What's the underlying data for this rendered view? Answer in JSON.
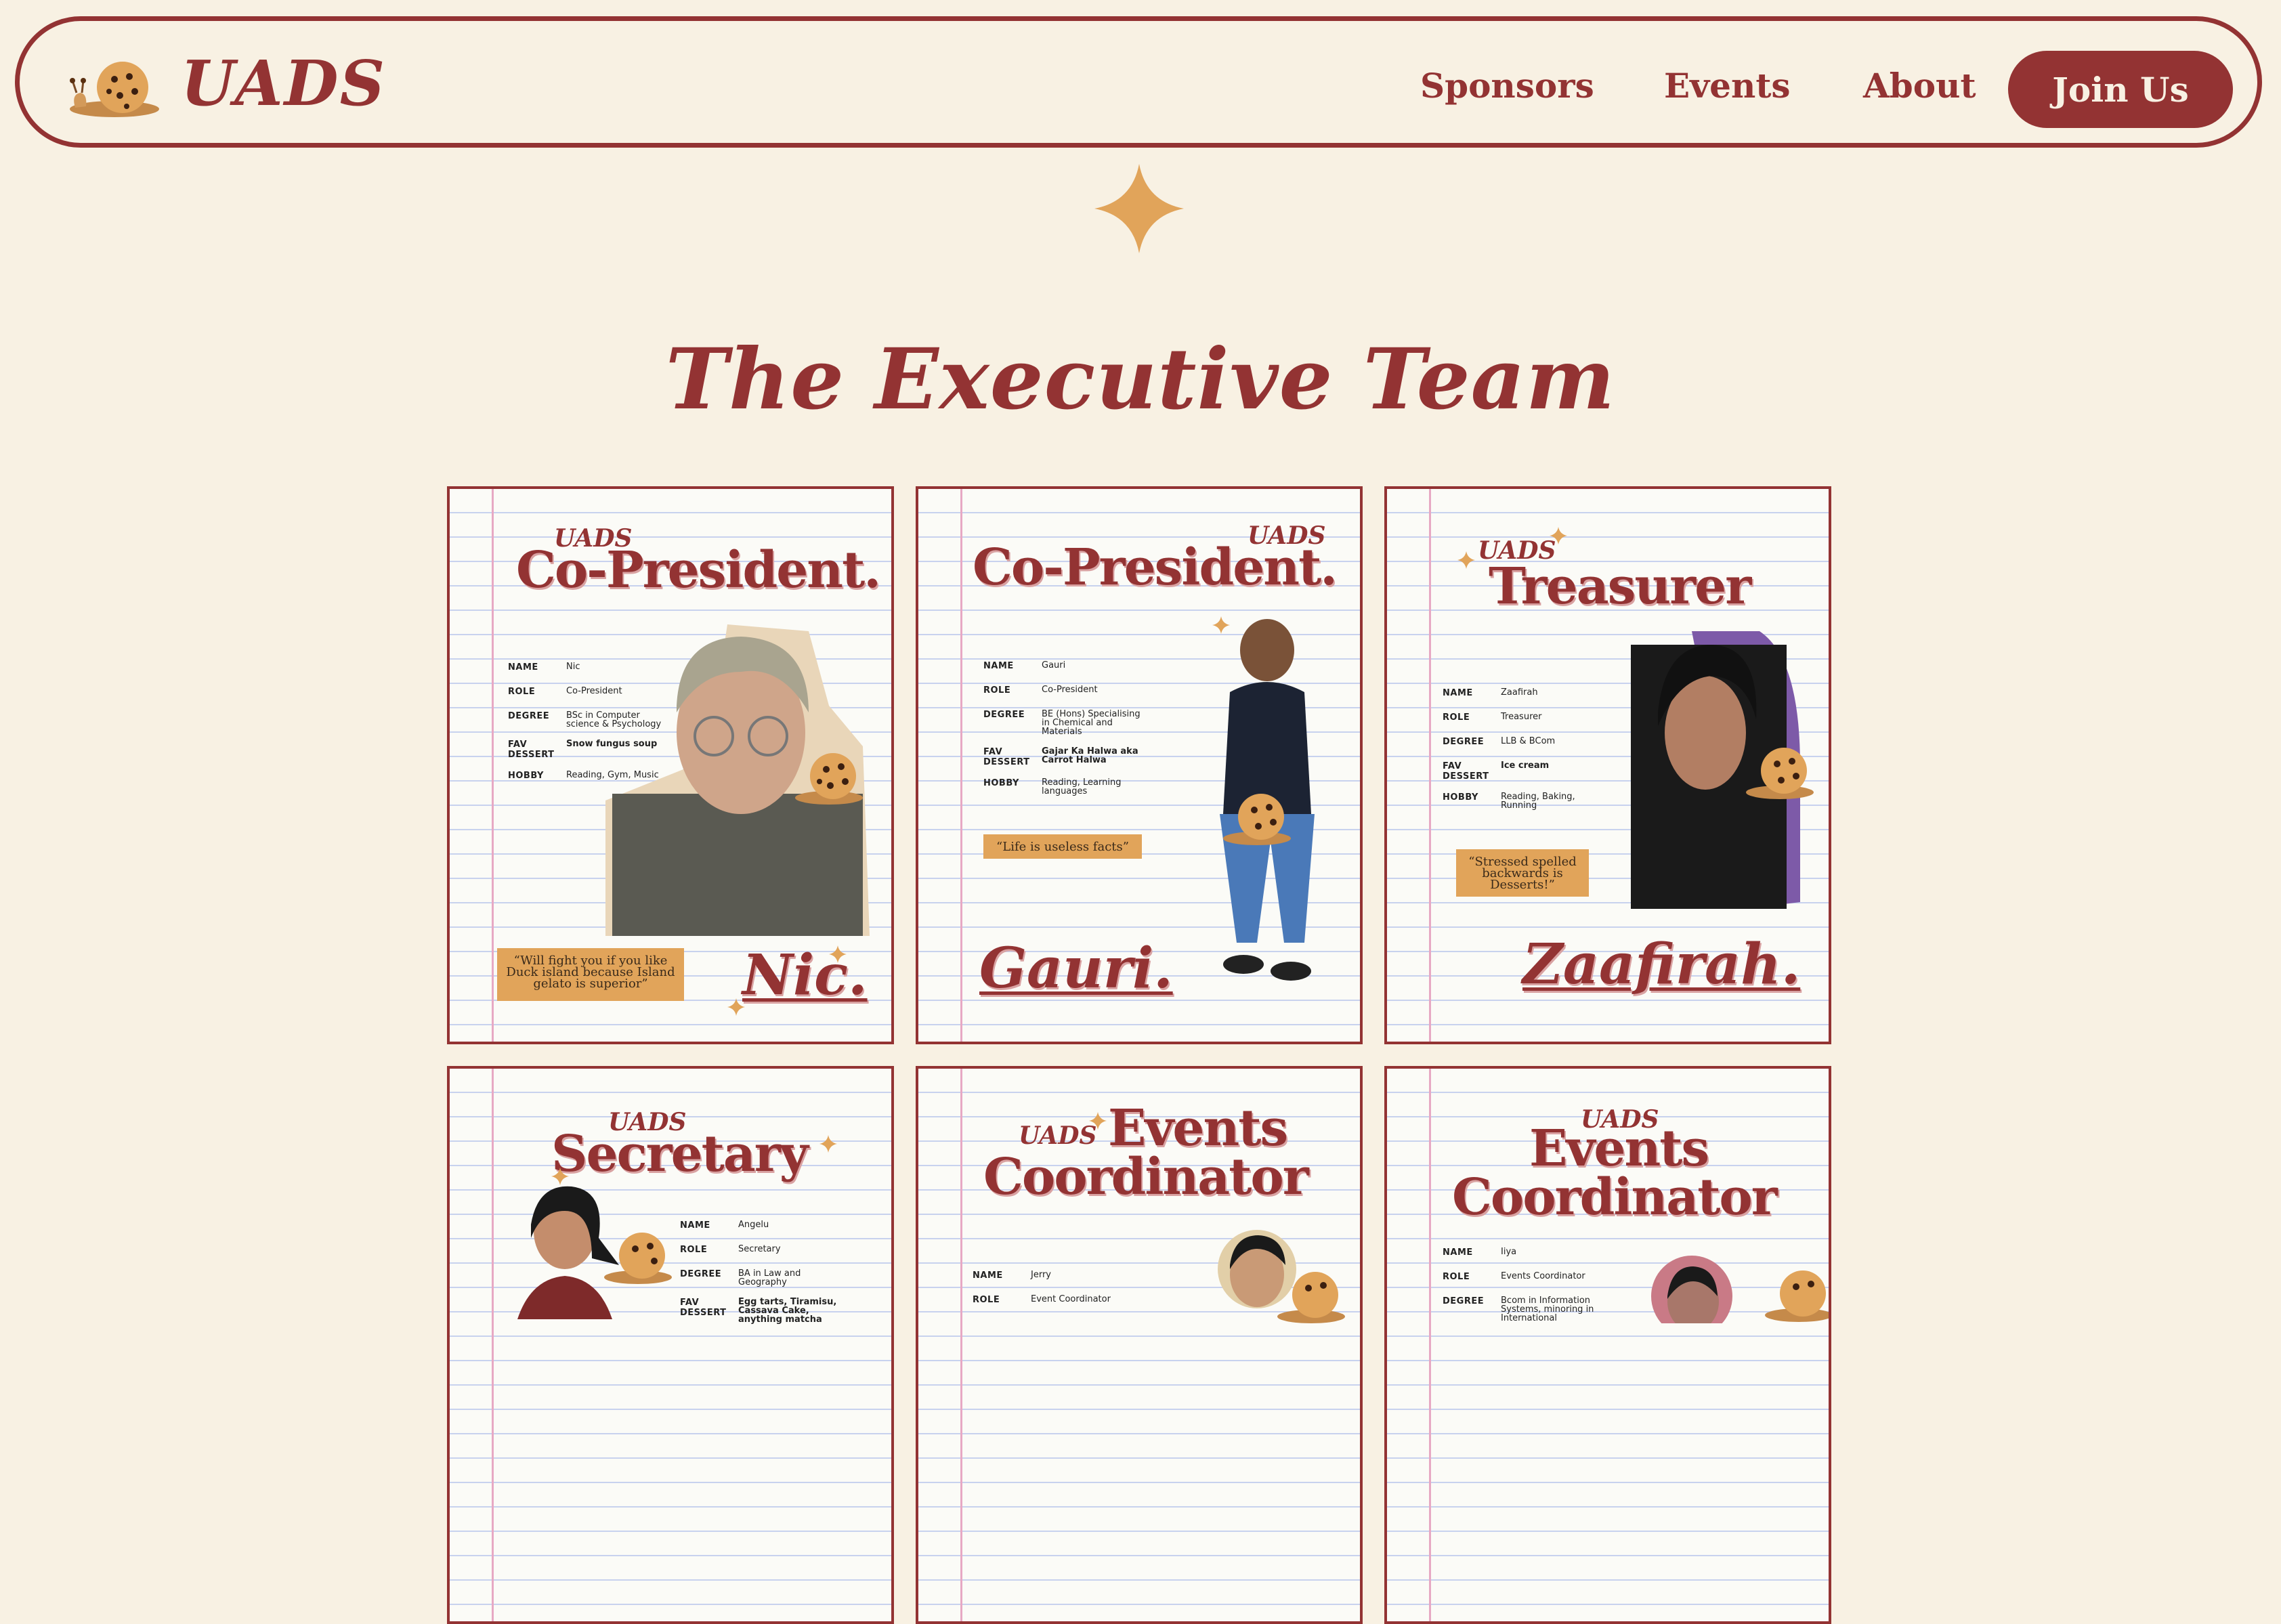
{
  "nav": {
    "logo_text": "UADS",
    "links": [
      "Sponsors",
      "Events",
      "About"
    ],
    "join_label": "Join Us"
  },
  "section": {
    "title": "The Executive Team"
  },
  "cards": [
    {
      "uads": "UADS",
      "title": "Co-President.",
      "info": {
        "labels": [
          "NAME",
          "ROLE",
          "DEGREE",
          "FAV DESSERT",
          "HOBBY"
        ],
        "values": [
          "Nic",
          "Co-President",
          "BSc in Computer science & Psychology",
          "Snow fungus soup",
          "Reading, Gym, Music"
        ]
      },
      "quote": "“Will fight you if you like Duck island because Island gelato is superior”",
      "name": "Nic."
    },
    {
      "uads": "UADS",
      "title": "Co-President.",
      "info": {
        "labels": [
          "NAME",
          "ROLE",
          "DEGREE",
          "FAV DESSERT",
          "HOBBY"
        ],
        "values": [
          "Gauri",
          "Co-President",
          "BE (Hons) Specialising in Chemical and Materials",
          "Gajar Ka Halwa aka Carrot Halwa",
          "Reading, Learning languages"
        ]
      },
      "quote": "“Life is useless facts”",
      "name": "Gauri."
    },
    {
      "uads": "UADS",
      "title": "Treasurer",
      "info": {
        "labels": [
          "NAME",
          "ROLE",
          "DEGREE",
          "FAV DESSERT",
          "HOBBY"
        ],
        "values": [
          "Zaafirah",
          "Treasurer",
          "LLB & BCom",
          "Ice cream",
          "Reading, Baking, Running"
        ]
      },
      "quote": "“Stressed spelled backwards is Desserts!”",
      "name": "Zaafirah."
    },
    {
      "uads": "UADS",
      "title": "Secretary",
      "info": {
        "labels": [
          "NAME",
          "ROLE",
          "DEGREE",
          "FAV DESSERT"
        ],
        "values": [
          "Angelu",
          "Secretary",
          "BA in Law and Geography",
          "Egg tarts, Tiramisu, Cassava Cake, anything matcha"
        ]
      }
    },
    {
      "uads": "UADS",
      "title_line1": "Events",
      "title_line2": "Coordinator",
      "info": {
        "labels": [
          "NAME",
          "ROLE"
        ],
        "values": [
          "Jerry",
          "Event Coordinator"
        ]
      }
    },
    {
      "uads": "UADS",
      "title_line1": "Events",
      "title_line2": "Coordinator",
      "info": {
        "labels": [
          "NAME",
          "ROLE",
          "DEGREE"
        ],
        "values": [
          "Iiya",
          "Events Coordinator",
          "Bcom in Information Systems, minoring in International"
        ]
      }
    }
  ],
  "colors": {
    "brand": "#933333",
    "background": "#f8f1e3",
    "accent": "#e1a45a",
    "quote_bg": "#e1a45a"
  },
  "icons": [
    "snail-cookie-icon",
    "sparkle-icon"
  ]
}
